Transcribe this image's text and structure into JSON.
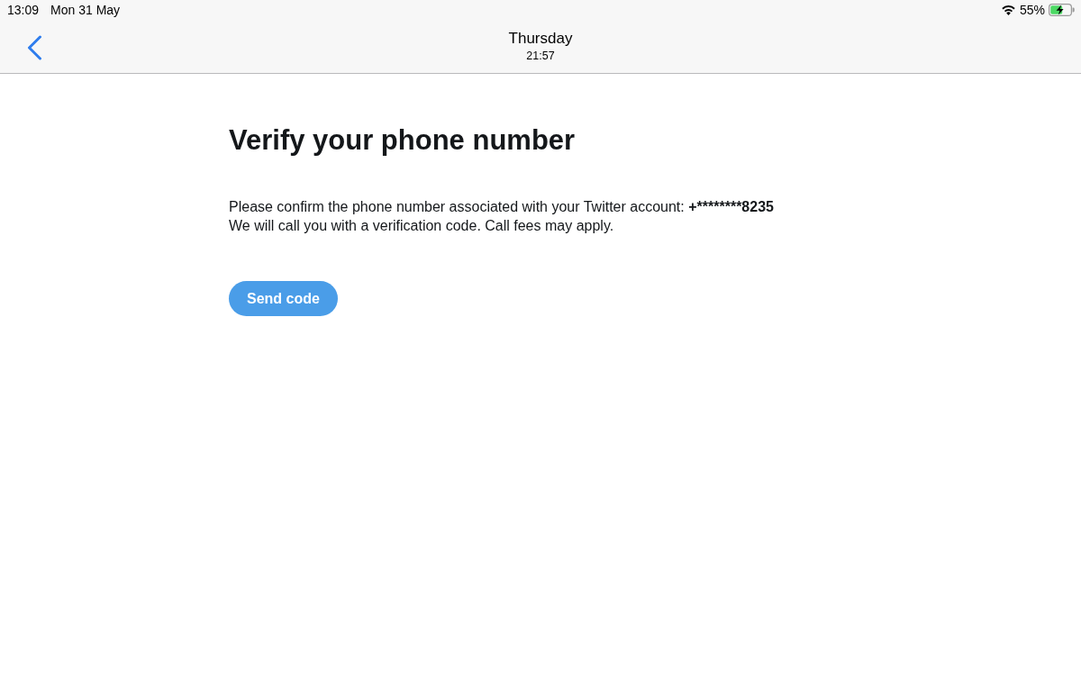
{
  "status_bar": {
    "time": "13:09",
    "date": "Mon 31 May",
    "battery": "55%"
  },
  "nav_bar": {
    "title": "Thursday",
    "subtitle": "21:57"
  },
  "heading": "Verify your phone number",
  "message": {
    "text": "Please confirm the phone number associated with your Twitter account:",
    "phone_number": "+********8235"
  },
  "note": "We will call you with a verification code. Call fees may apply.",
  "button": {
    "label": "Send code"
  }
}
